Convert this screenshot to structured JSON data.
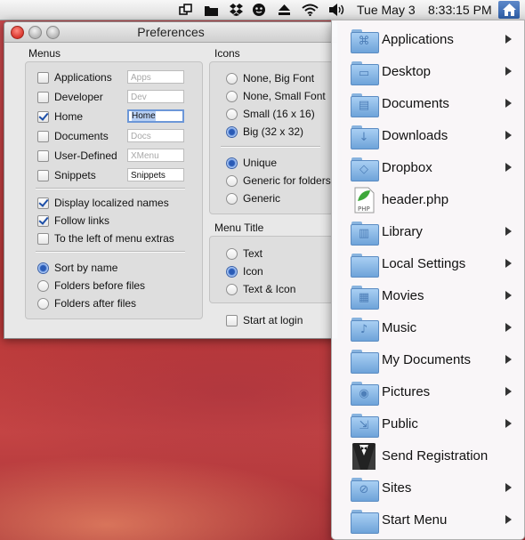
{
  "menubar": {
    "date": "Tue May 3",
    "time": "8:33:15 PM",
    "icons": [
      "window-switch-icon",
      "folder-icon",
      "dropbox-icon",
      "face-icon",
      "eject-icon",
      "wifi-icon",
      "volume-icon",
      "home-icon"
    ]
  },
  "preferences": {
    "title": "Preferences",
    "menus_label": "Menus",
    "menus": [
      {
        "label": "Applications",
        "checked": false,
        "field": "Apps"
      },
      {
        "label": "Developer",
        "checked": false,
        "field": "Dev"
      },
      {
        "label": "Home",
        "checked": true,
        "field": "Home"
      },
      {
        "label": "Documents",
        "checked": false,
        "field": "Docs"
      },
      {
        "label": "User-Defined",
        "checked": false,
        "field": "XMenu"
      },
      {
        "label": "Snippets",
        "checked": false,
        "field": "Snippets"
      }
    ],
    "options": [
      {
        "label": "Display localized names",
        "checked": true
      },
      {
        "label": "Follow links",
        "checked": true
      },
      {
        "label": "To the left of menu extras",
        "checked": false
      }
    ],
    "sort": [
      {
        "label": "Sort by name",
        "selected": true
      },
      {
        "label": "Folders before files",
        "selected": false
      },
      {
        "label": "Folders after files",
        "selected": false
      }
    ],
    "icons_label": "Icons",
    "icon_sizes": [
      {
        "label": "None, Big Font",
        "selected": false
      },
      {
        "label": "None, Small Font",
        "selected": false
      },
      {
        "label": "Small (16 x 16)",
        "selected": false
      },
      {
        "label": "Big (32 x 32)",
        "selected": true
      }
    ],
    "icon_styles": [
      {
        "label": "Unique",
        "selected": true
      },
      {
        "label": "Generic for folders",
        "selected": false
      },
      {
        "label": "Generic",
        "selected": false
      }
    ],
    "menu_title_label": "Menu Title",
    "menu_title": [
      {
        "label": "Text",
        "selected": false
      },
      {
        "label": "Icon",
        "selected": true
      },
      {
        "label": "Text & Icon",
        "selected": false
      }
    ],
    "start_at_login": {
      "label": "Start at login",
      "checked": false
    }
  },
  "dropdown": {
    "items": [
      {
        "label": "Applications",
        "icon": "applications-folder-icon",
        "submenu": true
      },
      {
        "label": "Desktop",
        "icon": "desktop-folder-icon",
        "submenu": true
      },
      {
        "label": "Documents",
        "icon": "documents-folder-icon",
        "submenu": true
      },
      {
        "label": "Downloads",
        "icon": "downloads-folder-icon",
        "submenu": true
      },
      {
        "label": "Dropbox",
        "icon": "dropbox-folder-icon",
        "submenu": true
      },
      {
        "label": "header.php",
        "icon": "php-file-icon",
        "submenu": false
      },
      {
        "label": "Library",
        "icon": "library-folder-icon",
        "submenu": true
      },
      {
        "label": "Local Settings",
        "icon": "folder-icon",
        "submenu": true
      },
      {
        "label": "Movies",
        "icon": "movies-folder-icon",
        "submenu": true
      },
      {
        "label": "Music",
        "icon": "music-folder-icon",
        "submenu": true
      },
      {
        "label": "My Documents",
        "icon": "folder-icon",
        "submenu": true
      },
      {
        "label": "Pictures",
        "icon": "pictures-folder-icon",
        "submenu": true
      },
      {
        "label": "Public",
        "icon": "public-folder-icon",
        "submenu": true
      },
      {
        "label": "Send Registration",
        "icon": "tuxedo-app-icon",
        "submenu": false
      },
      {
        "label": "Sites",
        "icon": "sites-folder-icon",
        "submenu": true
      },
      {
        "label": "Start Menu",
        "icon": "folder-icon",
        "submenu": true
      }
    ]
  },
  "colors": {
    "accent": "#2a5bb6",
    "desktop": "#c44444",
    "folder": "#6ea3d9"
  }
}
